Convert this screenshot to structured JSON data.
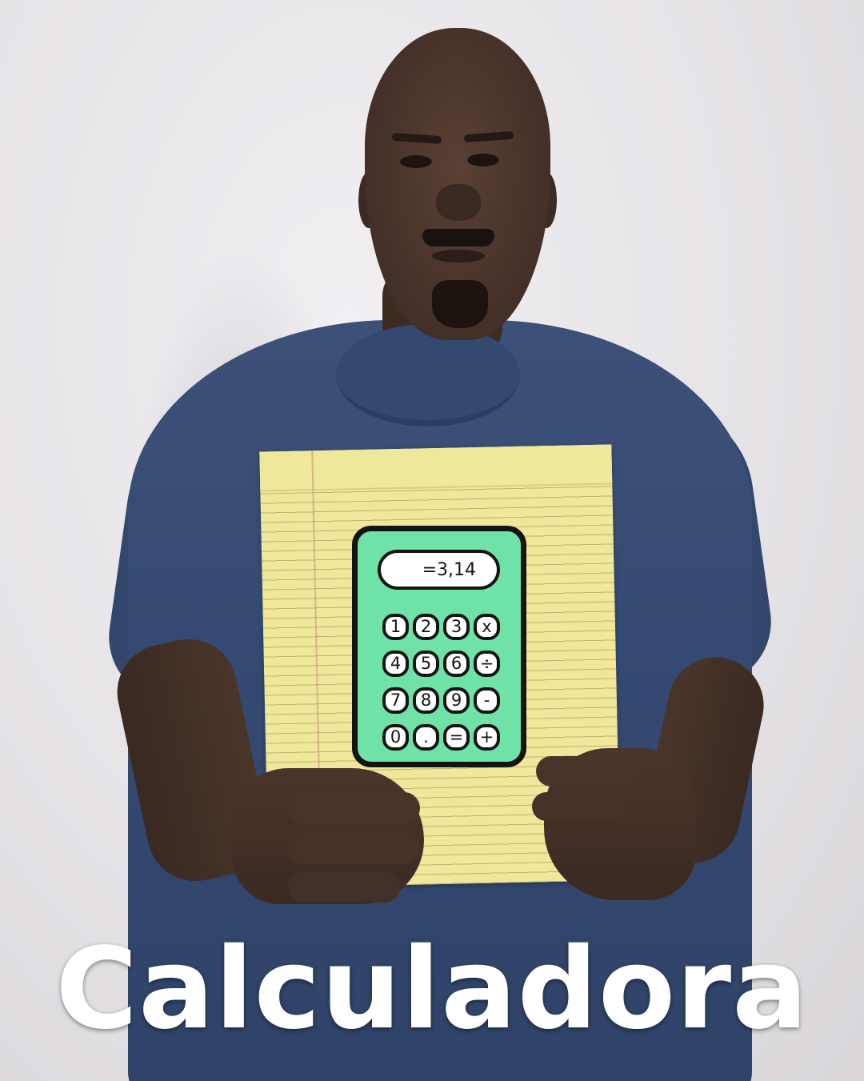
{
  "calculator": {
    "display": "=3,14",
    "keys": [
      "1",
      "2",
      "3",
      "x",
      "4",
      "5",
      "6",
      "÷",
      "7",
      "8",
      "9",
      "-",
      "0",
      ".",
      "=",
      "+"
    ]
  },
  "caption": "Calculadora",
  "colors": {
    "calculator_body": "#6fe2a8",
    "notepad": "#f0e79a",
    "shirt": "#354a72",
    "caption_text": "#ffffff"
  }
}
